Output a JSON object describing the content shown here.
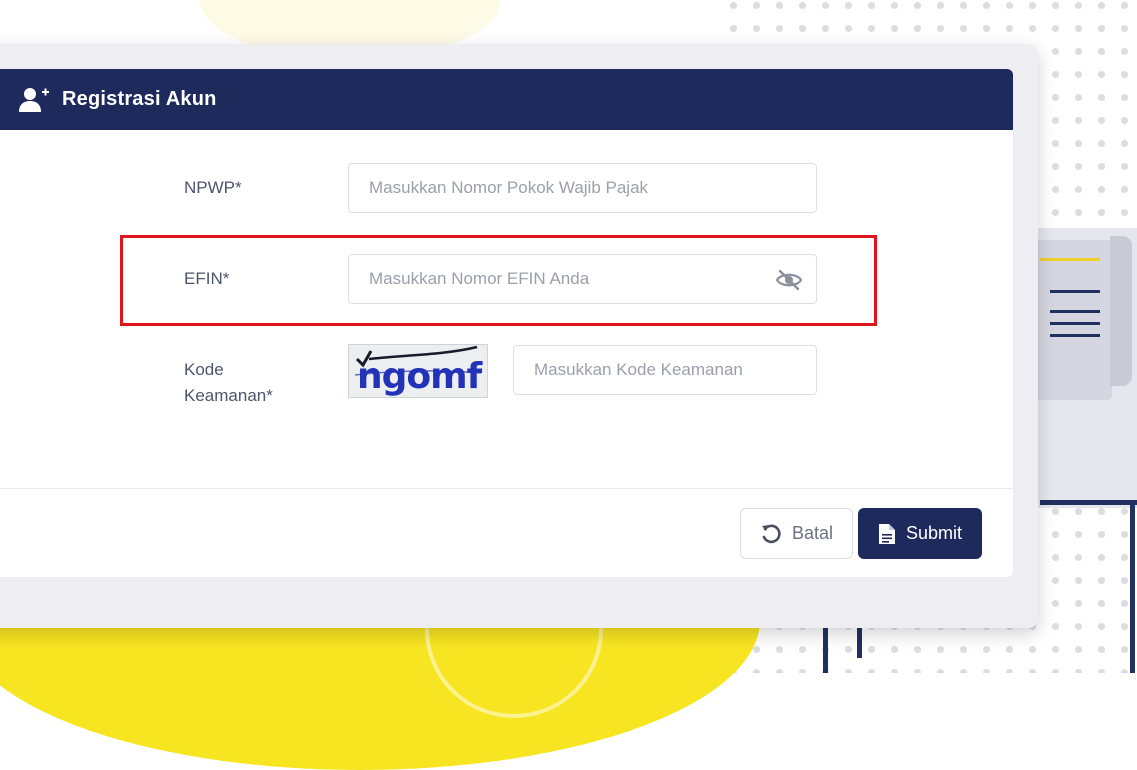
{
  "dialog": {
    "title": "Registrasi Akun",
    "header_icon": "user-plus-icon"
  },
  "form": {
    "npwp": {
      "label": "NPWP*",
      "placeholder": "Masukkan Nomor Pokok Wajib Pajak",
      "value": ""
    },
    "efin": {
      "label": "EFIN*",
      "placeholder": "Masukkan Nomor EFIN Anda",
      "value": "",
      "toggle_icon": "eye-slash-icon"
    },
    "security_code": {
      "label_line1": "Kode",
      "label_line2": "Keamanan*",
      "captcha_text": "ngomf",
      "placeholder": "Masukkan Kode Keamanan",
      "value": ""
    }
  },
  "actions": {
    "cancel_label": "Batal",
    "cancel_icon": "undo-icon",
    "submit_label": "Submit",
    "submit_icon": "document-icon"
  },
  "colors": {
    "header_bg": "#1f2a5c",
    "submit_bg": "#1f2a5c",
    "highlight_border": "#e0161e",
    "background_accent": "#f8e521",
    "captcha_text": "#2333b8"
  }
}
